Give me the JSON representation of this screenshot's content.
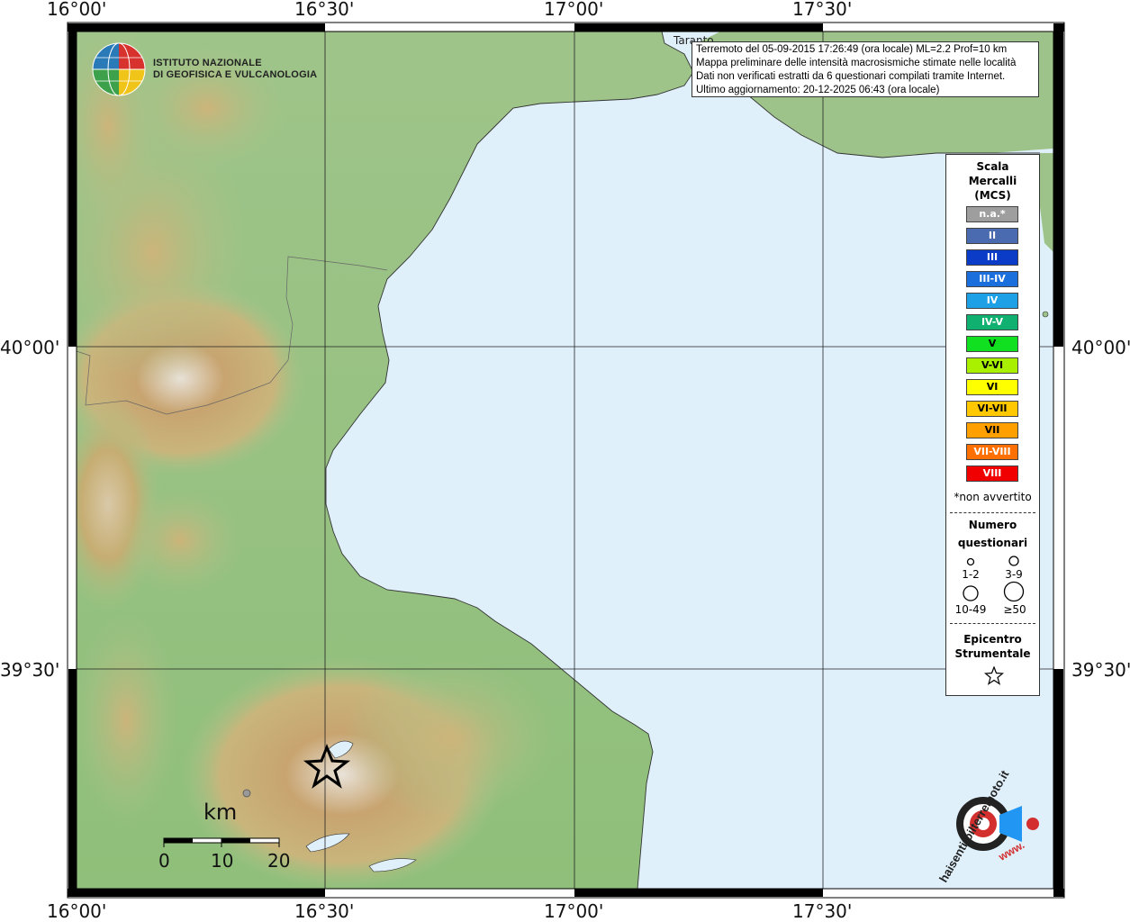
{
  "map": {
    "lon_labels": [
      "16°00'",
      "16°30'",
      "17°00'",
      "17°30'"
    ],
    "lat_labels": [
      "40°00'",
      "39°30'"
    ],
    "place_label": "Taranto"
  },
  "logo": {
    "line1": "ISTITUTO NAZIONALE",
    "line2": "DI GEOFISICA E VULCANOLOGIA"
  },
  "info": {
    "line1": "Terremoto del 05-09-2015 17:26:49 (ora locale) ML=2.2 Prof=10 km",
    "line2": "Mappa preliminare delle intensità macrosismiche stimate nelle località",
    "line3": "Dati non verificati estratti da 6 questionari compilati tramite Internet.",
    "line4": "Ultimo aggiornamento: 20-12-2025 06:43 (ora locale)"
  },
  "legend": {
    "title1": "Scala",
    "title2": "Mercalli",
    "title3": "(MCS)",
    "intensities": [
      {
        "label": "n.a.*",
        "color": "#9e9e9e"
      },
      {
        "label": "II",
        "color": "#4a6bb0"
      },
      {
        "label": "III",
        "color": "#0a3cc8"
      },
      {
        "label": "III-IV",
        "color": "#1a6fdc"
      },
      {
        "label": "IV",
        "color": "#1ea0e6"
      },
      {
        "label": "IV-V",
        "color": "#10b070"
      },
      {
        "label": "V",
        "color": "#10e020"
      },
      {
        "label": "V-VI",
        "color": "#a8f000"
      },
      {
        "label": "VI",
        "color": "#ffff00"
      },
      {
        "label": "VI-VII",
        "color": "#ffc800"
      },
      {
        "label": "VII",
        "color": "#ffa000"
      },
      {
        "label": "VII-VIII",
        "color": "#ff7000"
      },
      {
        "label": "VIII",
        "color": "#f00000"
      }
    ],
    "note": "*non avvertito",
    "count_title1": "Numero",
    "count_title2": "questionari",
    "count_labels": [
      "1-2",
      "3-9",
      "10-49",
      "≥50"
    ],
    "epi_title1": "Epicentro",
    "epi_title2": "Strumentale"
  },
  "scalebar": {
    "unit": "km",
    "ticks": [
      "0",
      "10",
      "20"
    ]
  },
  "brand": {
    "text": "haisentitoilterremoto.it",
    "www": "www."
  }
}
